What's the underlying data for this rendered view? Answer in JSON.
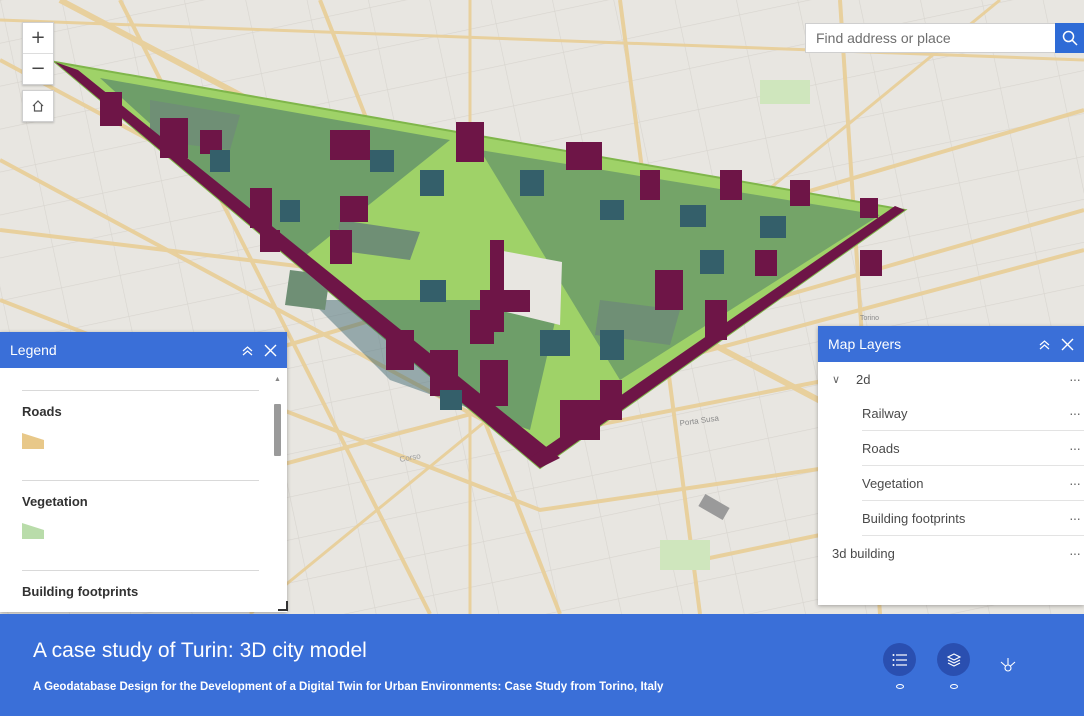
{
  "search": {
    "placeholder": "Find address or place"
  },
  "zoom": {
    "in_label": "+",
    "out_label": "−"
  },
  "legend": {
    "title": "Legend",
    "sections": [
      {
        "label": "Roads",
        "color": "#e8c889"
      },
      {
        "label": "Vegetation",
        "color": "#b9dcaa"
      },
      {
        "label": "Building footprints"
      }
    ]
  },
  "layers": {
    "title": "Map Layers",
    "group": {
      "label": "2d",
      "children": [
        "Railway",
        "Roads",
        "Vegetation",
        "Building footprints"
      ]
    },
    "item": "3d building",
    "more": "···"
  },
  "footer": {
    "title": "A case study of Turin: 3D city model",
    "subtitle": "A Geodatabase Design for the Development of a Digital Twin for Urban Environments:  Case Study from Torino, Italy"
  },
  "map_labels": [
    "Porta Susa",
    "Corso",
    "Torino"
  ],
  "colors": {
    "accent": "#3a6fd8",
    "building_green": "#9fd268",
    "building_teal": "#345f6a",
    "building_purple": "#6e1547",
    "building_sage": "#6f8f75",
    "road": "#e8c889"
  }
}
